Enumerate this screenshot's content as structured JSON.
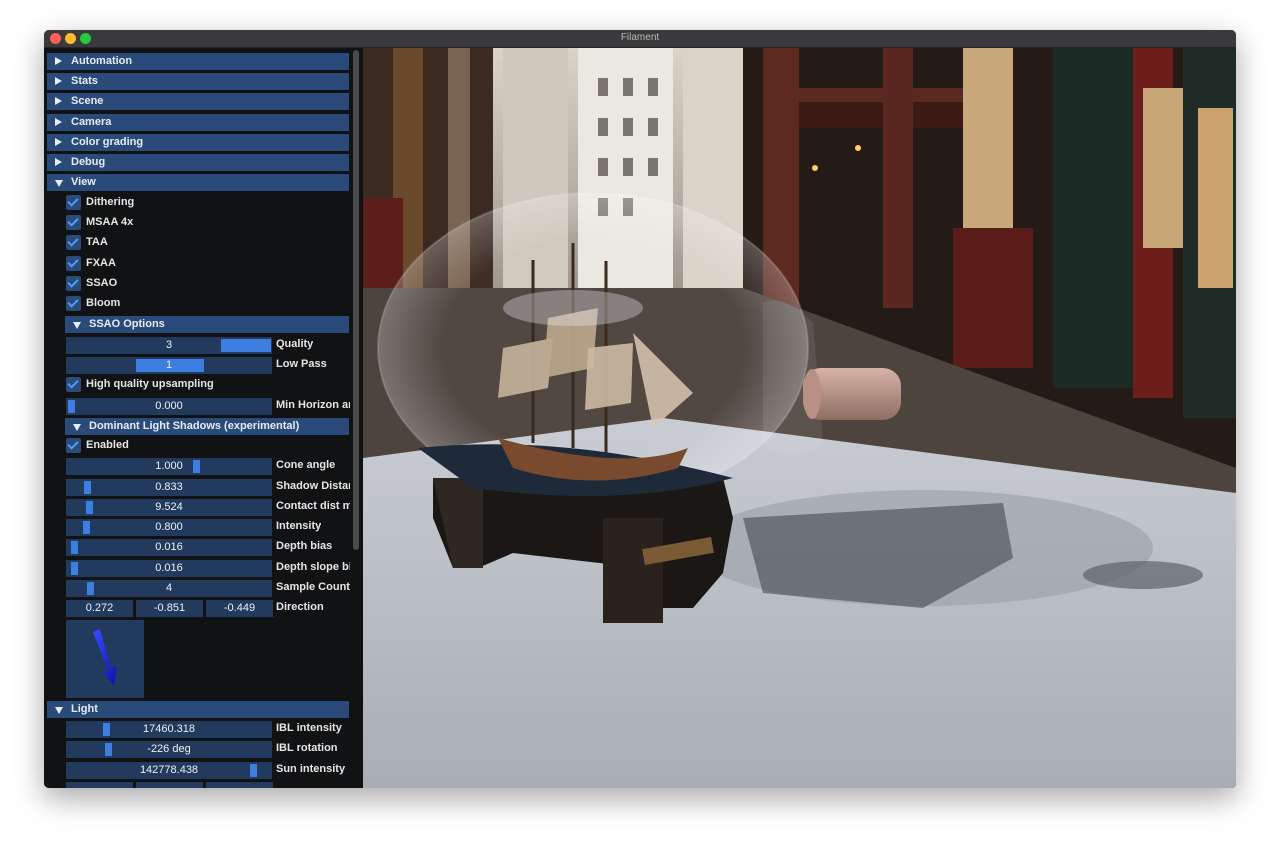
{
  "window": {
    "title": "Filament"
  },
  "sections": {
    "automation": "Automation",
    "stats": "Stats",
    "scene": "Scene",
    "camera": "Camera",
    "color_grading": "Color grading",
    "debug": "Debug",
    "view": "View",
    "light": "Light"
  },
  "view_options": {
    "dithering": "Dithering",
    "msaa": "MSAA 4x",
    "taa": "TAA",
    "fxaa": "FXAA",
    "ssao": "SSAO",
    "bloom": "Bloom"
  },
  "ssao_options": {
    "title": "SSAO Options",
    "quality_value": "3",
    "quality_label": "Quality",
    "low_pass_value": "1",
    "low_pass_label": "Low Pass",
    "hq_upsampling": "High quality upsampling",
    "min_horizon_value": "0.000",
    "min_horizon_label": "Min Horizon an"
  },
  "shadows": {
    "title": "Dominant Light Shadows (experimental)",
    "enabled": "Enabled",
    "cone_angle_value": "1.000",
    "cone_angle_label": "Cone angle",
    "shadow_distance_value": "0.833",
    "shadow_distance_label": "Shadow Distan",
    "contact_dist_value": "9.524",
    "contact_dist_label": "Contact dist ma",
    "intensity_value": "0.800",
    "intensity_label": "Intensity",
    "depth_bias_value": "0.016",
    "depth_bias_label": "Depth bias",
    "depth_slope_value": "0.016",
    "depth_slope_label": "Depth slope bia",
    "sample_count_value": "4",
    "sample_count_label": "Sample Count",
    "direction": [
      "0.272",
      "-0.851",
      "-0.449"
    ],
    "direction_label": "Direction"
  },
  "light": {
    "ibl_intensity_value": "17460.318",
    "ibl_intensity_label": "IBL intensity",
    "ibl_rotation_value": "-226 deg",
    "ibl_rotation_label": "IBL rotation",
    "sun_intensity_value": "142778.438",
    "sun_intensity_label": "Sun intensity"
  },
  "colors": {
    "header": "#2a4b79",
    "frame": "#213a5e",
    "accent": "#3d7fe0",
    "check": "#4a9dff"
  }
}
